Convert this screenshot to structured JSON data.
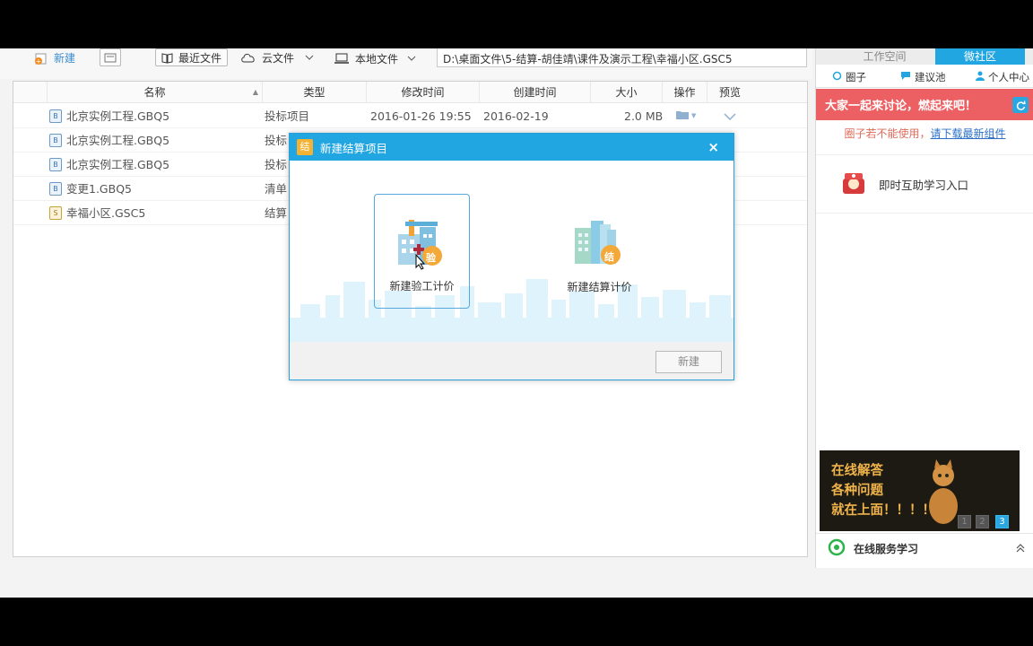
{
  "toolbar": {
    "new_label": "新建",
    "recent_label": "最近文件",
    "cloud_label": "云文件",
    "local_label": "本地文件",
    "path": "D:\\桌面文件\\5-结算-胡佳靖\\课件及演示工程\\幸福小区.GSC5"
  },
  "table": {
    "headers": {
      "name": "名称",
      "type": "类型",
      "modified": "修改时间",
      "created": "创建时间",
      "size": "大小",
      "action": "操作",
      "preview": "预览"
    },
    "rows": [
      {
        "icon": "gbq-file-icon",
        "name": "北京实例工程.GBQ5",
        "type": "投标项目",
        "modified": "2016-01-26 19:55",
        "created": "2016-02-19",
        "size": "2.0 MB"
      },
      {
        "icon": "gbq-file-icon",
        "name": "北京实例工程.GBQ5",
        "type": "投标"
      },
      {
        "icon": "gbq-file-icon",
        "name": "北京实例工程.GBQ5",
        "type": "投标"
      },
      {
        "icon": "gbq-file-icon",
        "name": "变更1.GBQ5",
        "type": "清单"
      },
      {
        "icon": "gsc-file-icon",
        "name": "幸福小区.GSC5",
        "type": "结算"
      }
    ]
  },
  "dialog": {
    "title": "新建结算项目",
    "title_icon_text": "结",
    "close": "×",
    "option1": "新建验工计价",
    "option1_badge": "验",
    "option2": "新建结算计价",
    "option2_badge": "结",
    "new_button": "新建"
  },
  "right": {
    "tab_workspace": "工作空间",
    "tab_community": "微社区",
    "sub_circle": "圈子",
    "sub_suggest": "建议池",
    "sub_personal": "个人中心",
    "banner": "大家一起来讨论，燃起来吧！",
    "notice_prefix": "圈子若不能使用，",
    "notice_link": "请下载最新组件",
    "learn": "即时互助学习入口",
    "ad_line1": "在线解答",
    "ad_line2": "各种问题",
    "ad_line3": "就在上面！！！！！",
    "ad_pages": [
      "1",
      "2",
      "3"
    ],
    "service": "在线服务学习"
  },
  "colors": {
    "accent_blue": "#22a6e2",
    "banner_red": "#ec5f62",
    "link_blue": "#2a70c8"
  }
}
